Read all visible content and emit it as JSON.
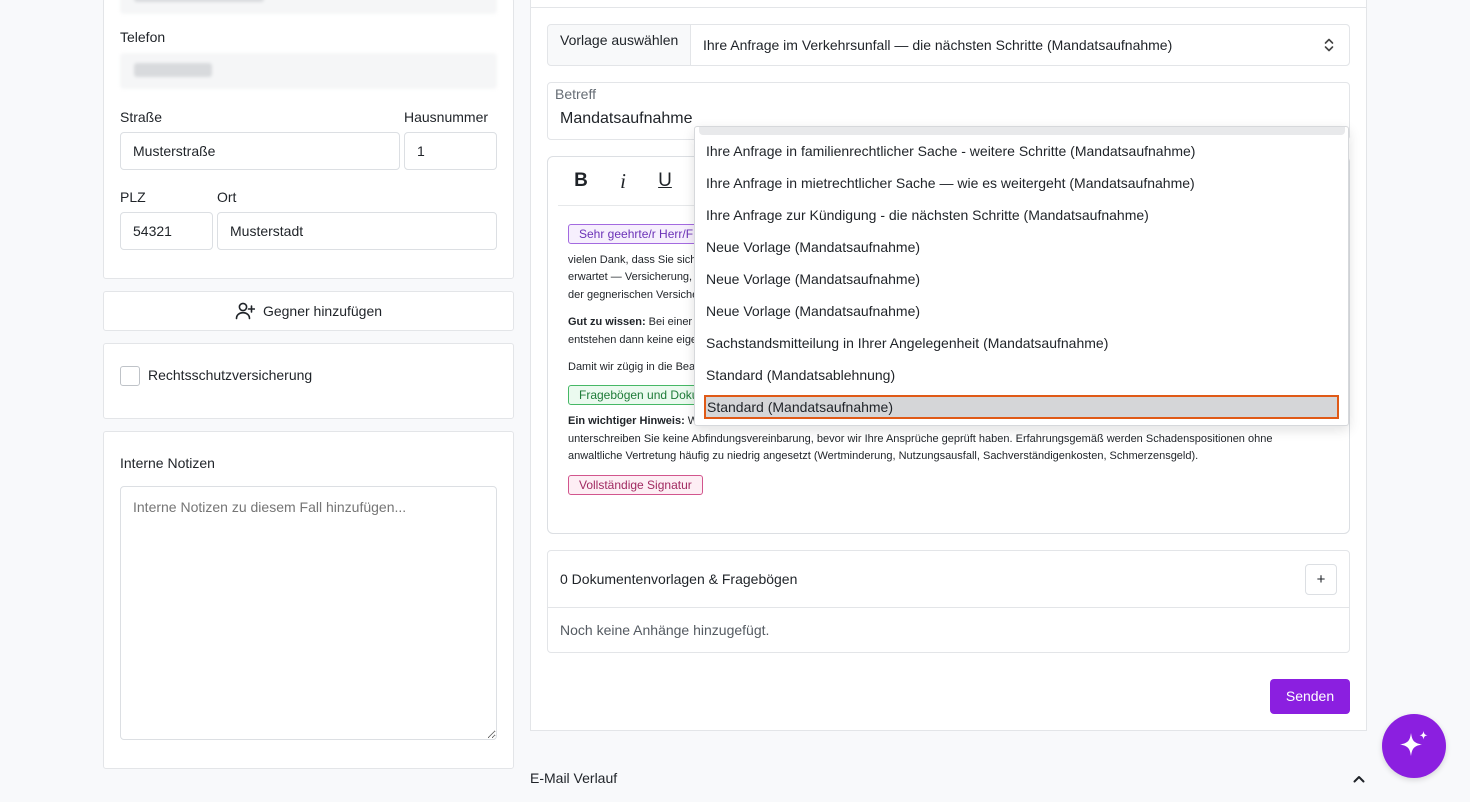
{
  "contact": {
    "telefon_label": "Telefon",
    "strasse_label": "Straße",
    "strasse_value": "Musterstraße",
    "hausnummer_label": "Hausnummer",
    "hausnummer_value": "1",
    "plz_label": "PLZ",
    "plz_value": "54321",
    "ort_label": "Ort",
    "ort_value": "Musterstadt"
  },
  "gegner_button": "Gegner hinzufügen",
  "rechtsschutz_label": "Rechtsschutzversicherung",
  "notes": {
    "title": "Interne Notizen",
    "placeholder": "Interne Notizen zu diesem Fall hinzufügen..."
  },
  "email": {
    "vorlage_label": "Vorlage auswählen",
    "vorlage_selected": "Ihre Anfrage im Verkehrsunfall — die nächsten Schritte (Mandatsaufnahme)",
    "betreff_label": "Betreff",
    "betreff_value": "Mandatsaufnahme",
    "toolbar": {
      "bold": "B",
      "italic": "i",
      "underline": "U"
    },
    "body": {
      "tag_salutation": "Sehr geehrte/r Herr/F",
      "line1": "vielen Dank, dass Sie sich",
      "line2": "erwartet — Versicherung,",
      "line3": "der gegnerischen Versiche",
      "gut_label": "Gut zu wissen:",
      "gut_text": " Bei einer",
      "gut_line2": "entstehen dann keine eige",
      "damit": "Damit wir zügig in die Bea",
      "tag_forms": "Fragebögen und Doku",
      "hinweis_label": "Ein wichtiger Hinweis:",
      "hinweis_text": " W",
      "hinweis_line2": "unterschreiben Sie keine Abfindungsvereinbarung, bevor wir Ihre Ansprüche geprüft haben. Erfahrungsgemäß werden Schadenspositionen ohne",
      "hinweis_line3": "anwaltliche Vertretung häufig zu niedrig angesetzt (Wertminderung, Nutzungsausfall, Sachverständigenkosten, Schmerzensgeld).",
      "tag_signature": "Vollständige Signatur"
    },
    "docs_title": "0 Dokumentenvorlagen & Fragebögen",
    "docs_add": "+",
    "docs_empty": "Noch keine Anhänge hinzugefügt.",
    "send": "Senden"
  },
  "verlauf_title": "E-Mail Verlauf",
  "dropdown": {
    "options": [
      "Ihre Anfrage in familienrechtlicher Sache - weitere Schritte (Mandatsaufnahme)",
      "Ihre Anfrage in mietrechtlicher Sache — wie es weitergeht (Mandatsaufnahme)",
      "Ihre Anfrage zur Kündigung - die nächsten Schritte (Mandatsaufnahme)",
      "Neue Vorlage (Mandatsaufnahme)",
      "Neue Vorlage (Mandatsaufnahme)",
      "Neue Vorlage (Mandatsaufnahme)",
      "Sachstandsmitteilung in Ihrer Angelegenheit (Mandatsaufnahme)",
      "Standard (Mandatsablehnung)",
      "Standard (Mandatsaufnahme)"
    ],
    "highlighted": "Standard (Mandatsaufnahme)"
  },
  "colors": {
    "accent": "#8b1fe0",
    "focus_outline": "#e05a17"
  },
  "icons": {
    "gegner": "user-plus-icon",
    "fab": "sparkle-icon",
    "verlauf": "chevron-up-icon",
    "select": "chevron-updown-icon"
  }
}
